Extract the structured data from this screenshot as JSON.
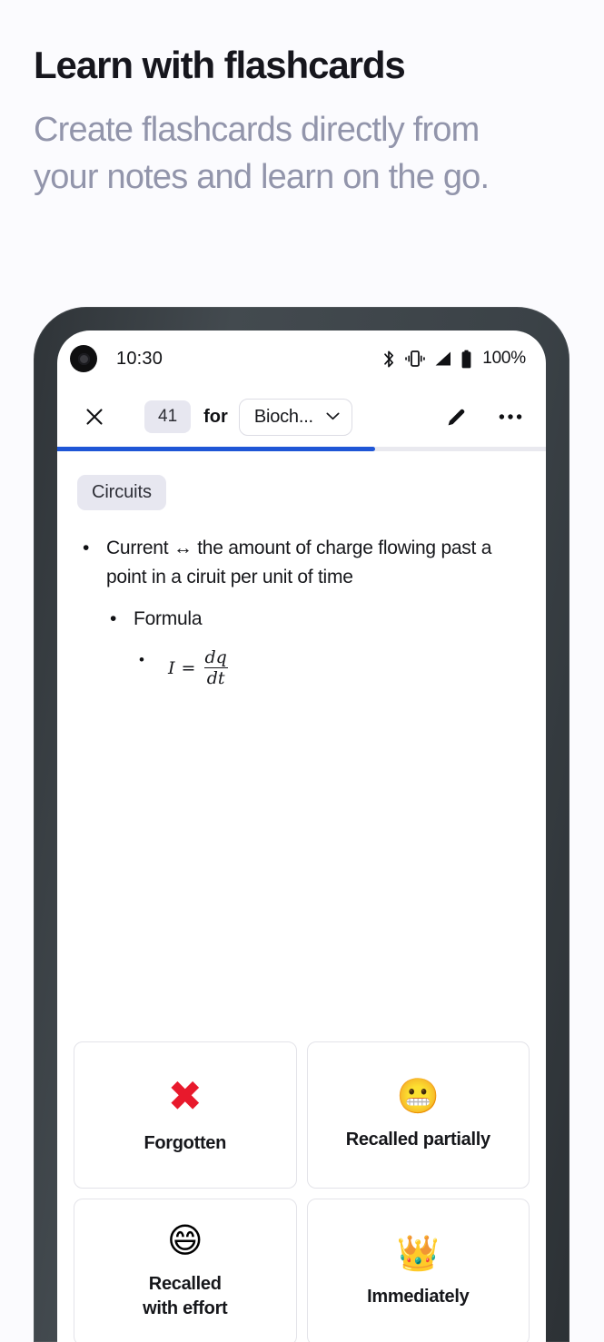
{
  "promo": {
    "title": "Learn with flashcards",
    "subtitle": "Create flashcards directly from your notes and learn on the go."
  },
  "colors": {
    "page_background": "#fbfbfe",
    "accent_progress": "#1f56d6",
    "chip_background": "#e7e7f0",
    "subtitle_text": "#9295ab",
    "phone_frame": "#3b4247",
    "forgotten_cross": "#e8192c"
  },
  "phone": {
    "status_bar": {
      "time": "10:30",
      "battery_percent": "100%",
      "icons": [
        "camera-hole",
        "bluetooth-icon",
        "vibrate-icon",
        "signal-icon",
        "battery-icon"
      ]
    },
    "toolbar": {
      "close_icon": "close-icon",
      "card_count": "41",
      "for_label": "for",
      "deck_name": "Bioch...",
      "chevron_icon": "chevron-down-icon",
      "edit_icon": "pencil-icon",
      "more_icon": "more-options-icon"
    },
    "progress": {
      "percent": 65
    },
    "card": {
      "topic_chip": "Circuits",
      "bullets": [
        {
          "level": 1,
          "marker": "•",
          "text": "Current ↔ the amount of charge flowing past a point in a ciruit per unit of time"
        },
        {
          "level": 2,
          "marker": "•",
          "text": "Formula"
        }
      ],
      "formula": {
        "marker": "•",
        "lhs": "I",
        "relation": "=",
        "numerator": "dq",
        "denominator": "dt"
      }
    },
    "answers": [
      {
        "emoji": "✖",
        "emoji_name": "red-cross-mark",
        "label": "Forgotten"
      },
      {
        "emoji": "😬",
        "emoji_name": "grimacing-face",
        "label": "Recalled partially"
      },
      {
        "emoji": "😄",
        "emoji_name": "grinning-face-smiling-eyes",
        "label": "Recalled\nwith effort"
      },
      {
        "emoji": "👑",
        "emoji_name": "crown",
        "label": "Immediately"
      }
    ]
  }
}
